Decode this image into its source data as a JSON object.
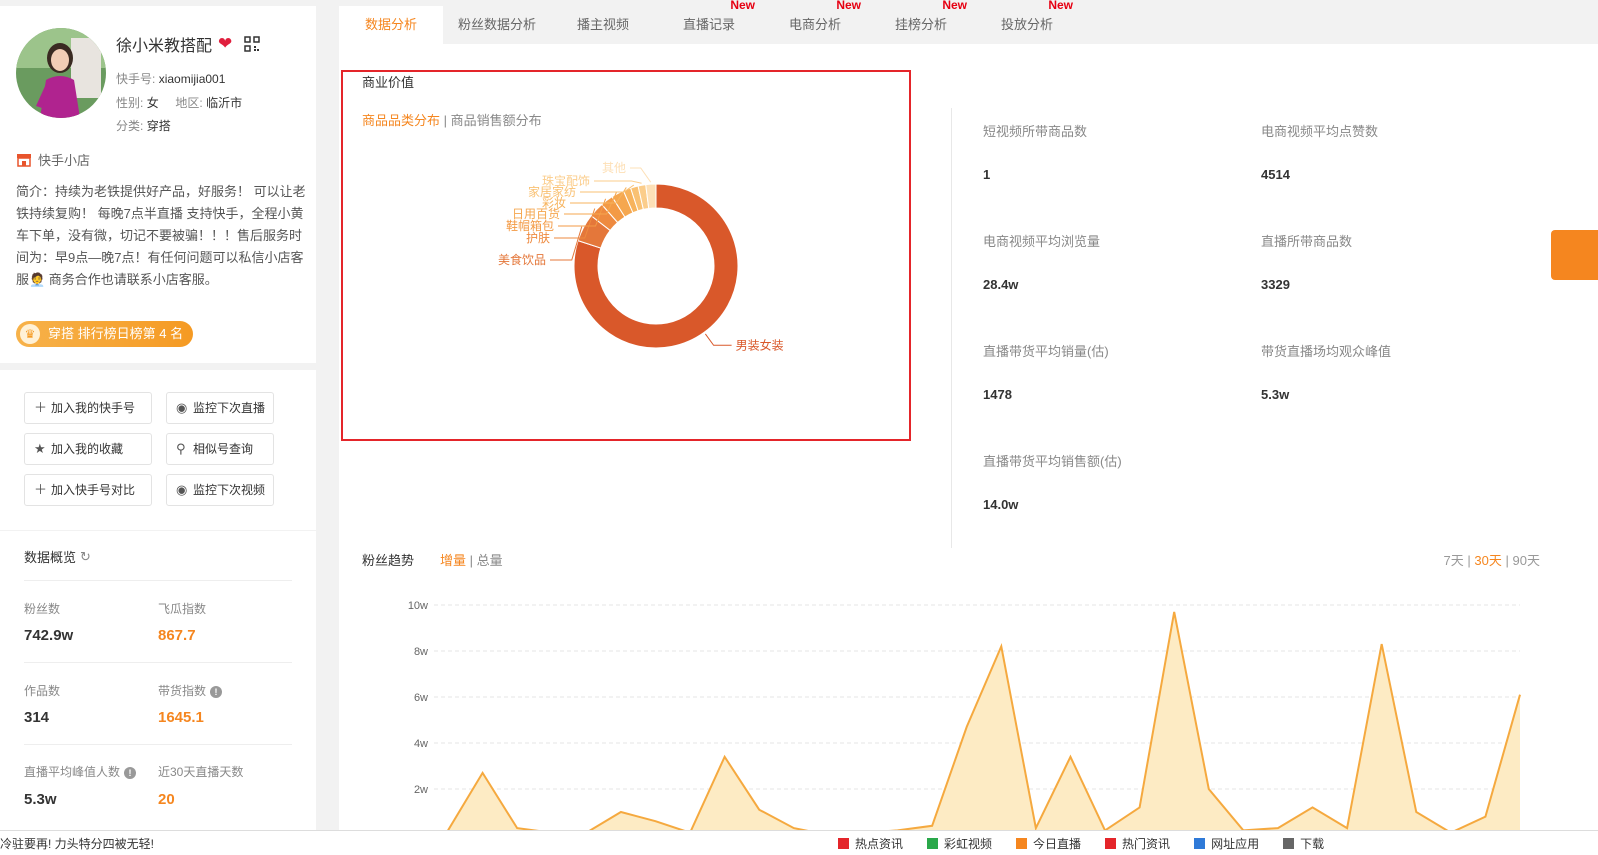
{
  "profile": {
    "name": "徐小米教搭配",
    "id_label": "快手号:",
    "id_value": "xiaomijia001",
    "gender_label": "性别:",
    "gender_value": "女",
    "region_label": "地区:",
    "region_value": "临沂市",
    "category_label": "分类:",
    "category_value": "穿搭",
    "shop_label": "快手小店",
    "intro": "简介：持续为老铁提供好产品，好服务！ 可以让老铁持续复购！ 每晚7点半直播 支持快手，全程小黄车下单，没有微，切记不要被骗！！！售后服务时间为：早9点—晚7点！有任何问题可以私信小店客服🧑‍💼 商务合作也请联系小店客服。",
    "rank_badge": "穿搭 排行榜日榜第 4 名"
  },
  "actions": [
    {
      "label": "加入我的快手号",
      "icon": "plus-icon"
    },
    {
      "label": "监控下次直播",
      "icon": "eye-icon"
    },
    {
      "label": "加入我的收藏",
      "icon": "star-icon"
    },
    {
      "label": "相似号查询",
      "icon": "search-icon"
    },
    {
      "label": "加入快手号对比",
      "icon": "plus-icon"
    },
    {
      "label": "监控下次视频",
      "icon": "eye-icon"
    }
  ],
  "overview": {
    "title": "数据概览",
    "stats": [
      {
        "label": "粉丝数",
        "value": "742.9w"
      },
      {
        "label": "飞瓜指数",
        "value": "867.7"
      },
      {
        "label": "作品数",
        "value": "314"
      },
      {
        "label": "带货指数",
        "value": "1645.1"
      },
      {
        "label": "直播平均峰值人数",
        "value": "5.3w"
      },
      {
        "label": "近30天直播天数",
        "value": "20"
      }
    ]
  },
  "tabs": [
    {
      "label": "数据分析",
      "new": ""
    },
    {
      "label": "粉丝数据分析",
      "new": ""
    },
    {
      "label": "播主视频",
      "new": ""
    },
    {
      "label": "直播记录",
      "new": "New"
    },
    {
      "label": "电商分析",
      "new": "New"
    },
    {
      "label": "挂榜分析",
      "new": "New"
    },
    {
      "label": "投放分析",
      "new": "New"
    }
  ],
  "business": {
    "title": "商业价值",
    "subtab_active": "商品品类分布",
    "subtab_sep": "|",
    "subtab_other": "商品销售额分布"
  },
  "chart_data": [
    {
      "type": "pie",
      "title": "",
      "categories": [
        "男装女装",
        "美食饮品",
        "护肤",
        "鞋帽箱包",
        "日用百货",
        "彩妆",
        "家居家纺",
        "珠宝配饰",
        "其他"
      ],
      "values": [
        80.0,
        5.5,
        3.0,
        2.5,
        2.5,
        1.5,
        1.5,
        1.5,
        2.0
      ],
      "colors": [
        "#d9582a",
        "#e4773a",
        "#ee8a3f",
        "#f39a45",
        "#f5a74f",
        "#f7b35c",
        "#f9c173",
        "#fbcd8b",
        "#fde0b7"
      ]
    },
    {
      "type": "area",
      "title": "粉丝趋势",
      "x": [
        1,
        2,
        3,
        4,
        5,
        6,
        7,
        8,
        9,
        10,
        11,
        12,
        13,
        14,
        15,
        16,
        17,
        18,
        19,
        20,
        21,
        22,
        23,
        24,
        25,
        26,
        27,
        28,
        29,
        30,
        31,
        32
      ],
      "values": [
        0.2,
        2.7,
        0.3,
        0.1,
        0.1,
        1.0,
        0.6,
        0.1,
        3.4,
        1.1,
        0.3,
        0.0,
        0.1,
        0.2,
        0.4,
        4.7,
        8.2,
        0.3,
        3.4,
        0.2,
        1.2,
        9.7,
        2.0,
        0.2,
        0.3,
        1.2,
        0.3,
        8.3,
        1.0,
        0.1,
        0.8,
        6.1
      ],
      "ylim": [
        0,
        10
      ],
      "ytick_labels": [
        "2w",
        "4w",
        "6w",
        "8w",
        "10w"
      ],
      "color": "#f5a93f",
      "fill": "#fdebc4",
      "grid": true
    }
  ],
  "kpis": [
    {
      "label": "短视频所带商品数",
      "value": "1"
    },
    {
      "label": "电商视频平均点赞数",
      "value": "4514"
    },
    {
      "label": "电商视频平均浏览量",
      "value": "28.4w"
    },
    {
      "label": "直播所带商品数",
      "value": "3329"
    },
    {
      "label": "直播带货平均销量(估)",
      "value": "1478"
    },
    {
      "label": "带货直播场均观众峰值",
      "value": "5.3w"
    },
    {
      "label": "直播带货平均销售额(估)",
      "value": "14.0w"
    }
  ],
  "trend": {
    "title": "粉丝趋势",
    "tab_active": "增量",
    "tab_sep": "|",
    "tab_other": "总量",
    "range": [
      "7天",
      "30天",
      "90天"
    ],
    "range_sep": "|",
    "range_active": "30天"
  },
  "bottom_bar": {
    "left_text": "冷驻要再! 力头特分四被无轻!",
    "items": [
      "热点资讯",
      "彩虹视频",
      "今日直播",
      "热门资讯",
      "网址应用",
      "下载"
    ]
  }
}
